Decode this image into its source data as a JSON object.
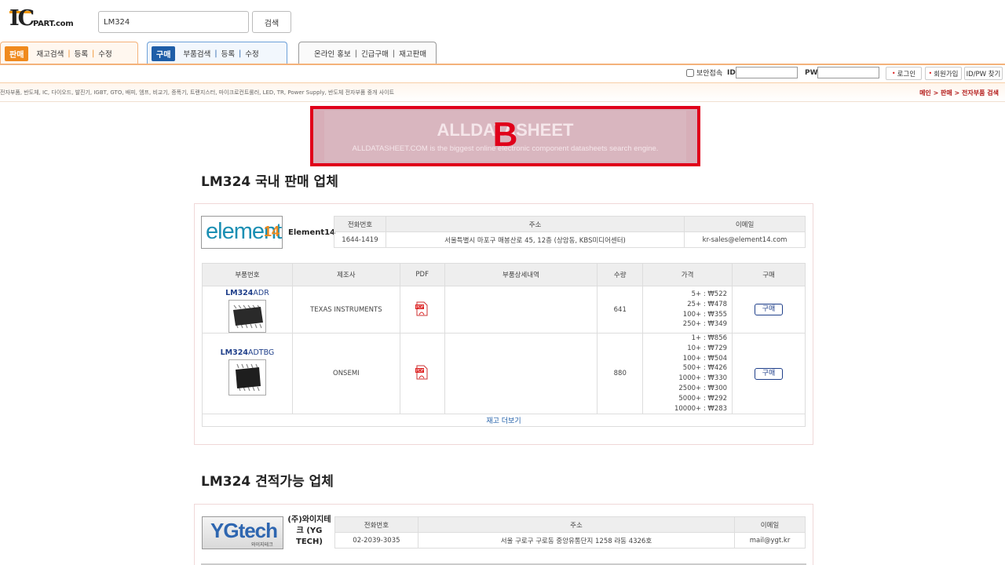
{
  "header": {
    "logo_ic": "IC",
    "logo_part": "PART.com",
    "search_value": "LM324",
    "search_button": "검색"
  },
  "tabs": {
    "sell": {
      "badge": "판매",
      "items": [
        "재고검색",
        "등록",
        "수정"
      ]
    },
    "buy": {
      "badge": "구매",
      "items": [
        "부품검색",
        "등록",
        "수정"
      ]
    },
    "etc": {
      "items": [
        "온라인 홍보",
        "긴급구매",
        "재고판매"
      ]
    }
  },
  "login": {
    "secure_label": "보안접속",
    "id_label": "ID",
    "pw_label": "PW",
    "login_button": "로그인",
    "join_button": "회원가입",
    "find_button": "ID/PW 찾기"
  },
  "subbar": {
    "description": "전자부품, 반도체, IC, 다이오드, 발진기, IGBT, GTO, 배피, 엠프, 비교기, 증폭기, 트랜지스터, 마이크로컨트롤러, LED, TR, Power Supply, 반도체 전자부품 중개 사이트",
    "breadcrumb": "메인 > 판매 > 전자부품 검색"
  },
  "banner": {
    "title": "ALLDATASHEET",
    "subtitle": "ALLDATASHEET.COM is the biggest online electronic component datasheets search engine.",
    "mark": "B"
  },
  "domestic": {
    "title": "LM324 국내 판매 업체",
    "vendor": {
      "logo_text": "element",
      "logo_num": "14",
      "name": "Element14",
      "headers": [
        "전화번호",
        "주소",
        "이메일"
      ],
      "phone": "1644-1419",
      "address": "서울특별시 마포구 매봉산로 45, 12층 (상암동, KBS미디어센터)",
      "email": "kr-sales@element14.com"
    },
    "stock_headers": [
      "부품번호",
      "제조사",
      "PDF",
      "부품상세내역",
      "수량",
      "가격",
      "구매"
    ],
    "rows": [
      {
        "part_main": "LM324",
        "part_suffix": "ADR",
        "maker": "TEXAS INSTRUMENTS",
        "qty": "641",
        "prices": [
          "5+ : ₩522",
          "25+ : ₩478",
          "100+ : ₩355",
          "250+ : ₩349"
        ],
        "buy": "구매"
      },
      {
        "part_main": "LM324",
        "part_suffix": "ADTBG",
        "maker": "ONSEMI",
        "qty": "880",
        "prices": [
          "1+ : ₩856",
          "10+ : ₩729",
          "100+ : ₩504",
          "500+ : ₩426",
          "1000+ : ₩330",
          "2500+ : ₩300",
          "5000+ : ₩292",
          "10000+ : ₩283"
        ],
        "buy": "구매"
      }
    ],
    "more": "재고 더보기"
  },
  "quote": {
    "title": "LM324 견적가능 업체",
    "vendor": {
      "logo_text": "YGtech",
      "logo_sub": "와이지테크",
      "name_line1": "(주)와이지테",
      "name_line2": "크 (YG",
      "name_line3": "TECH)",
      "headers": [
        "전화번호",
        "주소",
        "이메일"
      ],
      "phone": "02-2039-3035",
      "address": "서울 구로구 구로동 중앙유통단지 1258 라동 4326호",
      "email": "mail@ygt.kr"
    }
  },
  "colors": {
    "accent_orange": "#f08a1e",
    "accent_blue": "#1f5ea8",
    "banner_border": "#e0001a"
  }
}
